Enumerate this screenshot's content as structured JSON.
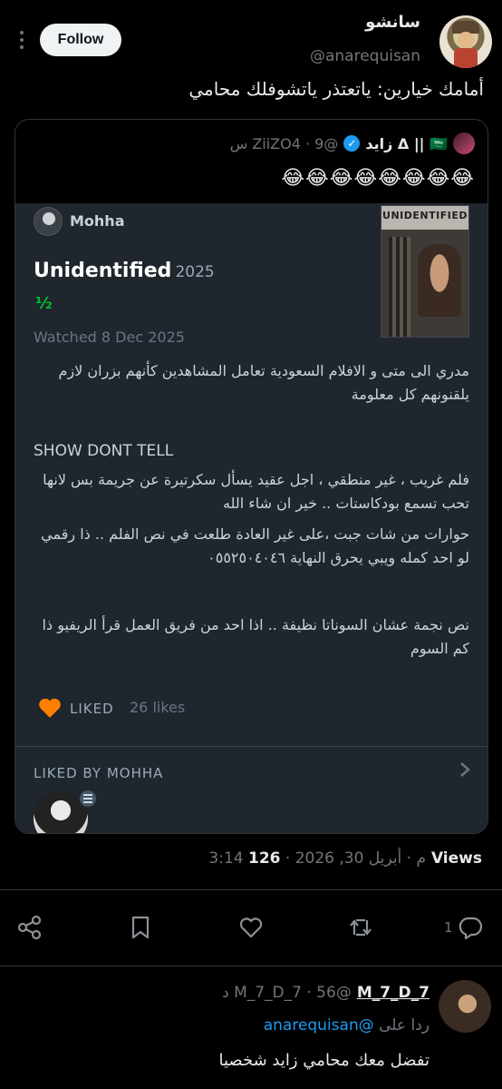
{
  "tweet": {
    "display_name": "سانشو",
    "handle": "@anarequisan",
    "follow_label": "Follow",
    "text": "أمامك خيارين: ياتعتذر ياتشوفلك محامي"
  },
  "quote": {
    "name": "Δ || 🇸🇦 زايد",
    "handle_time": "@ZiiZO4 · 9 س",
    "emoji_text": "😂😂😂😂😂😂😂😂",
    "card": {
      "user": "Mohha",
      "film_title": "Unidentified",
      "film_year": "2025",
      "rating": "½",
      "watched": "Watched 8 Dec 2025",
      "poster_title": "UNIDENTIFIED",
      "review_p1": "مدري الى متى و الافلام السعودية تعامل المشاهدين كأنهم بزران لازم يلقنونهم كل معلومة",
      "review_p2": "SHOW DONT TELL",
      "review_p3": "فلم غريب ، غير منطقي ، اجل عقيد يسأل سكرتيرة عن جريمة بس لانها تحب تسمع بودكاستات .. خير ان شاء الله",
      "review_p4": "حوارات من شات جبت ،على غير العادة طلعت في نص الفلم .. ذا رقمي لو احد كمله ويبي يحرق النهاية ٠٥٥٢٥٠٤٠٤٦",
      "review_p5": "نص نجمة عشان السوناتا نظيفة .. اذا احد من فريق العمل قرأ الريفيو ذا كم السوم",
      "liked_label": "LIKED",
      "likes": "26 likes",
      "liked_by": "LIKED BY MOHHA"
    }
  },
  "meta": {
    "time": "3:14 م · أبريل 30, 2026 · ",
    "views_count": "126",
    "views_label": " Views"
  },
  "actions": {
    "replies": "1",
    "icons": [
      "reply-icon",
      "like-icon",
      "bookmark-icon",
      "share-icon",
      "retweet-icon"
    ]
  },
  "reply": {
    "name": "M_7_D_7",
    "handle_time": "@M_7_D_7 · 56 د",
    "reply_to_prefix": "ردا على ",
    "reply_to_handle": "@anarequisan",
    "text": "تفضل معك محامي زايد شخصيا"
  },
  "colors": {
    "accent": "#1d9bf0",
    "rating_green": "#00c030",
    "heart_orange": "#ff8000",
    "card_bg": "#20262d"
  }
}
